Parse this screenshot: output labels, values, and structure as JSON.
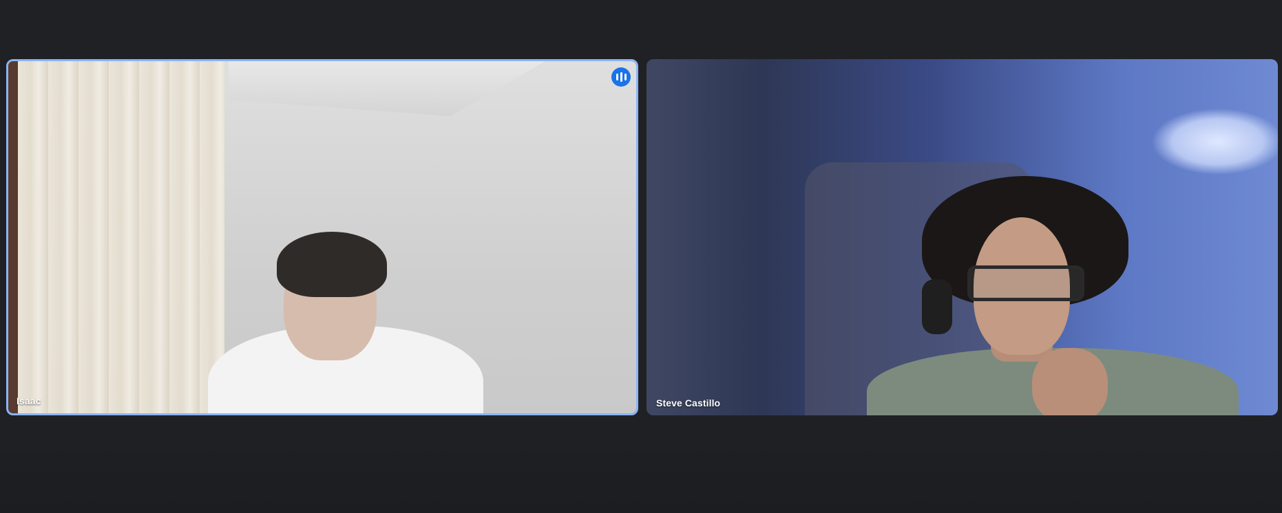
{
  "participants": [
    {
      "name": "Isaac",
      "speaking": true,
      "speaking_icon": "audio-level-icon"
    },
    {
      "name": "Steve Castillo",
      "speaking": false
    }
  ],
  "colors": {
    "background": "#202124",
    "active_border": "#8ab4f8",
    "speaking_indicator": "#1a73e8",
    "label_text": "#ffffff"
  }
}
